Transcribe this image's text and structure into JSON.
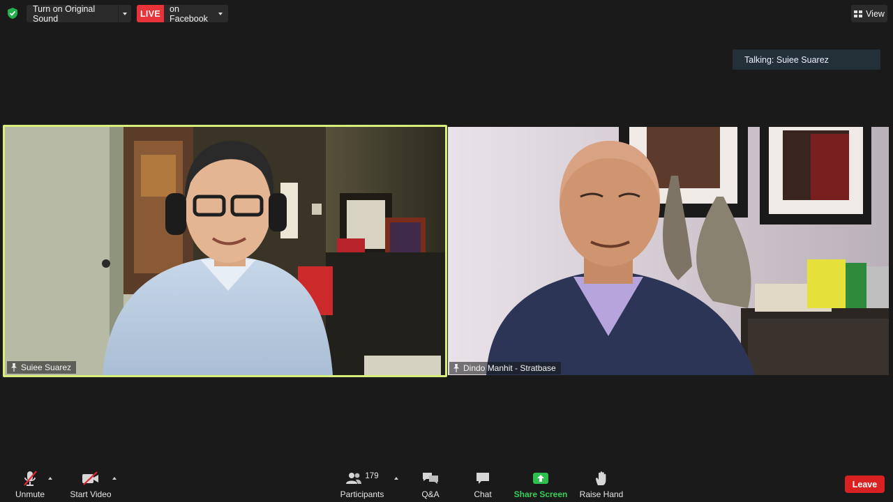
{
  "top_bar": {
    "original_sound_label": "Turn on Original Sound",
    "live_badge": "LIVE",
    "live_destination": "on Facebook",
    "view_label": "View"
  },
  "talking_indicator": "Talking: Suiee Suarez",
  "videos": [
    {
      "name": "Suiee Suarez",
      "active_speaker": true
    },
    {
      "name": "Dindo Manhit - Stratbase",
      "active_speaker": false
    }
  ],
  "toolbar": {
    "unmute_label": "Unmute",
    "start_video_label": "Start Video",
    "participants_label": "Participants",
    "participants_count": "179",
    "qa_label": "Q&A",
    "chat_label": "Chat",
    "share_screen_label": "Share Screen",
    "raise_hand_label": "Raise Hand",
    "leave_label": "Leave"
  },
  "colors": {
    "background": "#1a1a1a",
    "live_red": "#e8333b",
    "active_speaker_border": "#d8ee7a",
    "share_green": "#34d058",
    "leave_red": "#d92121",
    "encryption_green": "#23b14d"
  },
  "icons": [
    "shield-check-icon",
    "view-grid-icon",
    "pin-icon",
    "muted-mic-icon",
    "video-off-icon",
    "participants-icon",
    "qa-icon",
    "chat-icon",
    "share-screen-icon",
    "raise-hand-icon"
  ]
}
